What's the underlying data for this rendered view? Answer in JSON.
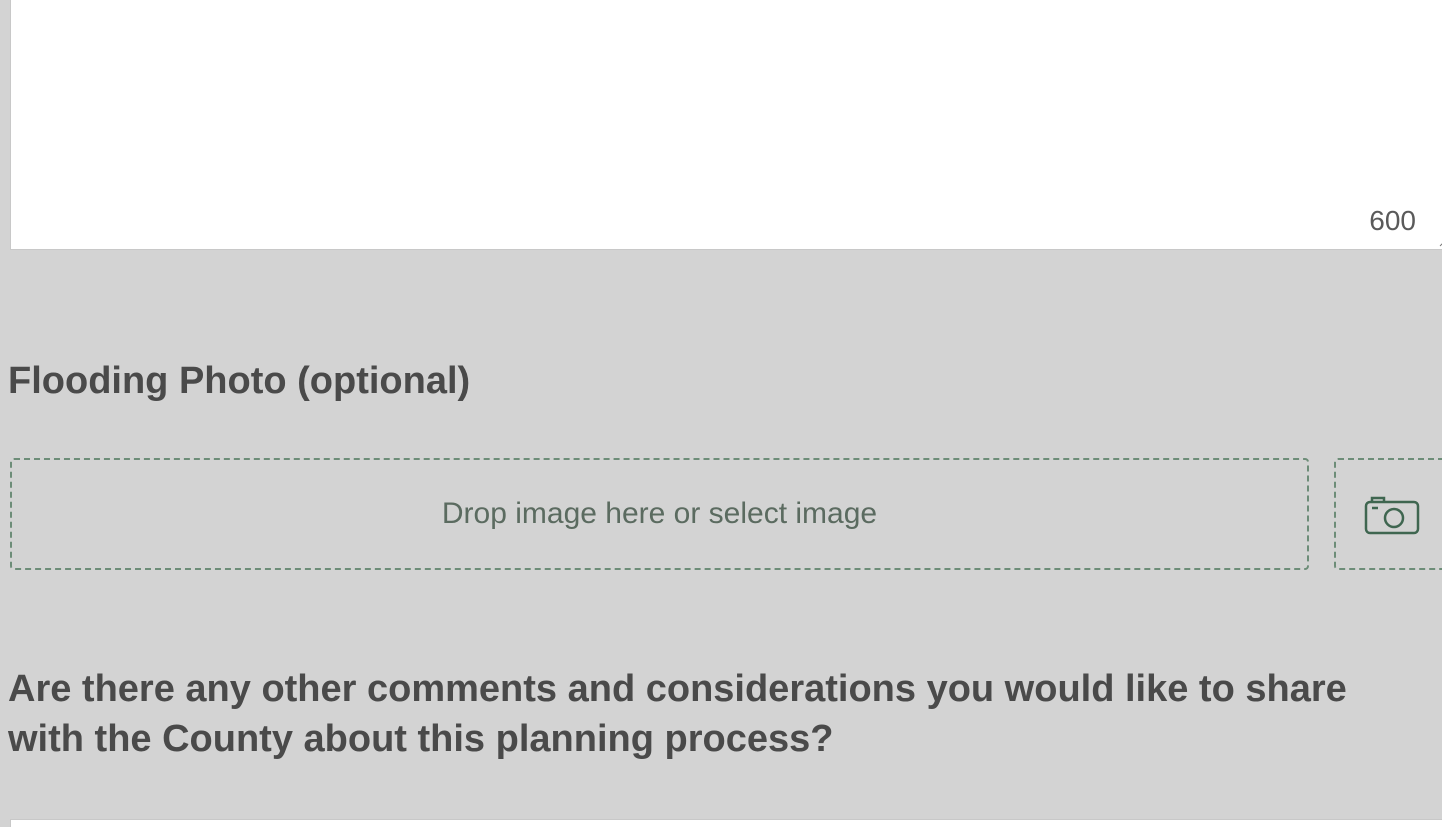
{
  "previous_textarea": {
    "char_count": "600"
  },
  "photo_question": {
    "label": "Flooding Photo (optional)",
    "dropzone_text": "Drop image here or select image"
  },
  "comments_question": {
    "label": "Are there any other comments and considerations you would like to share with the County about this planning process?"
  },
  "colors": {
    "page_background": "#d3d3d3",
    "accent_green": "#6d8d78",
    "label_text": "#4a4a4a"
  },
  "icons": {
    "camera": "camera-icon",
    "resize": "resize-handle-icon"
  }
}
